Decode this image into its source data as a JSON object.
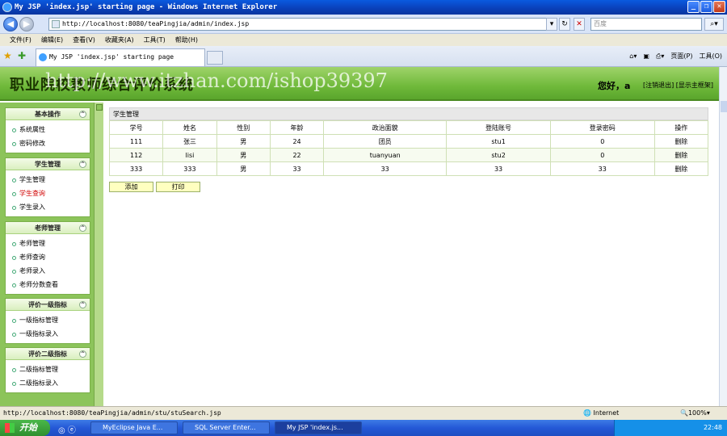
{
  "window": {
    "title": "My JSP 'index.jsp' starting page - Windows Internet Explorer"
  },
  "address": {
    "url": "http://localhost:8080/teaPingjia/admin/index.jsp",
    "search_placeholder": "百度"
  },
  "menu": [
    "文件(F)",
    "编辑(E)",
    "查看(V)",
    "收藏夹(A)",
    "工具(T)",
    "帮助(H)"
  ],
  "tab": {
    "title": "My JSP 'index.jsp' starting page"
  },
  "tools": {
    "page": "页面(P)",
    "tools": "工具(O)"
  },
  "header": {
    "system_title": "职业院校教师综合评价系统",
    "watermark": "http://www.itzhan.com/ishop39397",
    "greeting": "您好，a",
    "logout": "[注销退出]",
    "show_main": "[显示主框架]"
  },
  "sidebar": [
    {
      "title": "基本操作",
      "items": [
        "系统属性",
        "密码修改"
      ]
    },
    {
      "title": "学生管理",
      "items": [
        "学生管理",
        "学生查询",
        "学生录入"
      ]
    },
    {
      "title": "老师管理",
      "items": [
        "老师管理",
        "老师查询",
        "老师录入",
        "老师分数查看"
      ]
    },
    {
      "title": "评价一级指标",
      "items": [
        "一级指标管理",
        "一级指标录入"
      ]
    },
    {
      "title": "评价二级指标",
      "items": [
        "二级指标管理",
        "二级指标录入"
      ]
    }
  ],
  "content": {
    "panel_title": "学生管理",
    "columns": [
      "学号",
      "姓名",
      "性别",
      "年龄",
      "政治面貌",
      "登陆账号",
      "登录密码",
      "操作"
    ],
    "rows": [
      [
        "111",
        "张三",
        "男",
        "24",
        "团员",
        "stu1",
        "0",
        "删除"
      ],
      [
        "112",
        "lisi",
        "男",
        "22",
        "tuanyuan",
        "stu2",
        "0",
        "删除"
      ],
      [
        "333",
        "333",
        "男",
        "33",
        "33",
        "33",
        "33",
        "删除"
      ]
    ],
    "add_button": "添加",
    "print_button": "打印"
  },
  "status": {
    "url": "http://localhost:8080/teaPingjia/admin/stu/stuSearch.jsp",
    "zone": "Internet",
    "zoom": "100%"
  },
  "taskbar": {
    "start": "开始",
    "tasks": [
      "MyEclipse Java E...",
      "SQL Server Enter...",
      "My JSP 'index.js..."
    ],
    "clock": "22:48"
  }
}
